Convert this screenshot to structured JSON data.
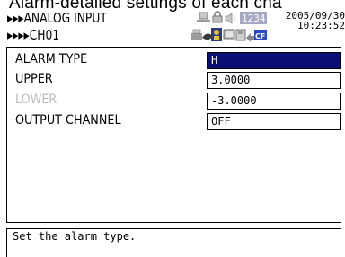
{
  "page_title": "Alarm-detailed settings of each cha",
  "breadcrumb": {
    "level1": "▸▸▸ANALOG INPUT",
    "level2": "▸▸▸▸CH01"
  },
  "status": {
    "counter_display": "1234",
    "memory_icon_label": "CF",
    "date": "2005/09/30",
    "time": "10:23:52"
  },
  "settings": [
    {
      "label": "ALARM TYPE",
      "value": "H",
      "selected": true,
      "enabled": true
    },
    {
      "label": "UPPER",
      "value": "3.0000",
      "selected": false,
      "enabled": true
    },
    {
      "label": "LOWER",
      "value": "-3.0000",
      "selected": false,
      "enabled": false
    },
    {
      "label": "OUTPUT CHANNEL",
      "value": "OFF",
      "selected": false,
      "enabled": true
    }
  ],
  "help_text": "Set the alarm type.",
  "colors": {
    "selected_field_bg": "#0b0f75",
    "disabled_label": "#bdbdbd",
    "counter_badge_bg": "#a6a9c4"
  }
}
